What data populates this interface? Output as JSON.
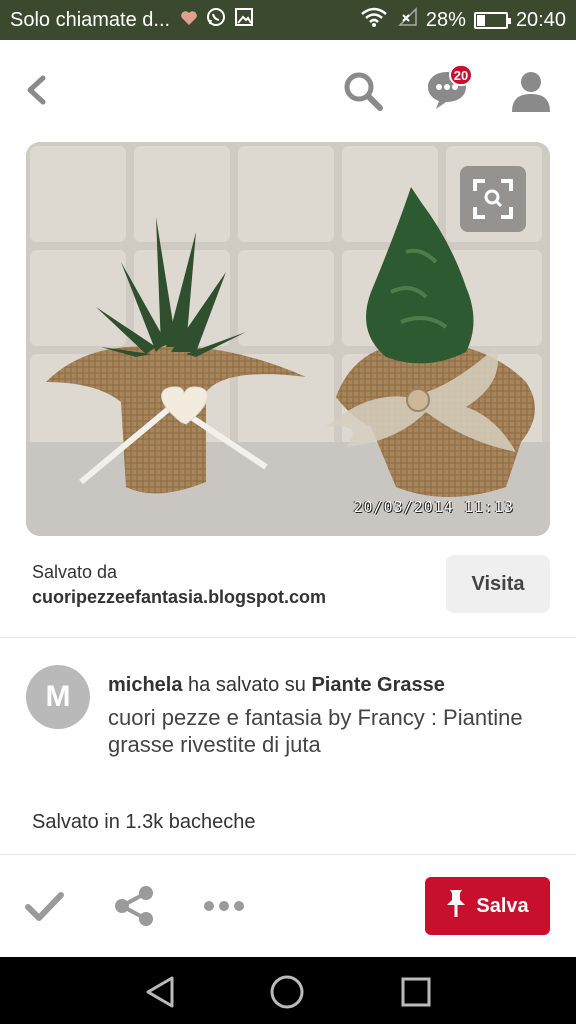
{
  "status_bar": {
    "notification_title": "Solo chiamate d...",
    "battery": "28%",
    "battery_level": 0.28,
    "time": "20:40",
    "icons": [
      "heart-icon",
      "whatsapp-icon",
      "gallery-icon",
      "wifi-icon",
      "no-signal-icon",
      "battery-icon"
    ]
  },
  "header": {
    "back_icon": "chevron-left-icon",
    "search_icon": "search-icon",
    "messages_icon": "chat-bubble-icon",
    "messages_badge": "20",
    "profile_icon": "person-icon"
  },
  "pin": {
    "image_alt_icon": "visual-search-icon",
    "timestamp": "20/03/2014  11:13"
  },
  "source": {
    "saved_from_label": "Salvato da",
    "url": "cuoripezzeefantasia.blogspot.com",
    "visit_label": "Visita"
  },
  "pinner": {
    "avatar_initial": "M",
    "user": "michela",
    "action": "ha salvato su",
    "board": "Piante Grasse",
    "description": "cuori pezze e fantasia by Francy : Piantine grasse rivestite di juta"
  },
  "stats": {
    "saved_in": "Salvato in 1.3k bacheche"
  },
  "actions": {
    "check_icon": "checkmark-icon",
    "share_icon": "share-icon",
    "more_icon": "more-dots-icon",
    "save_label": "Salva",
    "save_icon": "pushpin-icon"
  },
  "colors": {
    "accent": "#c8102e",
    "status_bar": "#3b4a2e"
  }
}
